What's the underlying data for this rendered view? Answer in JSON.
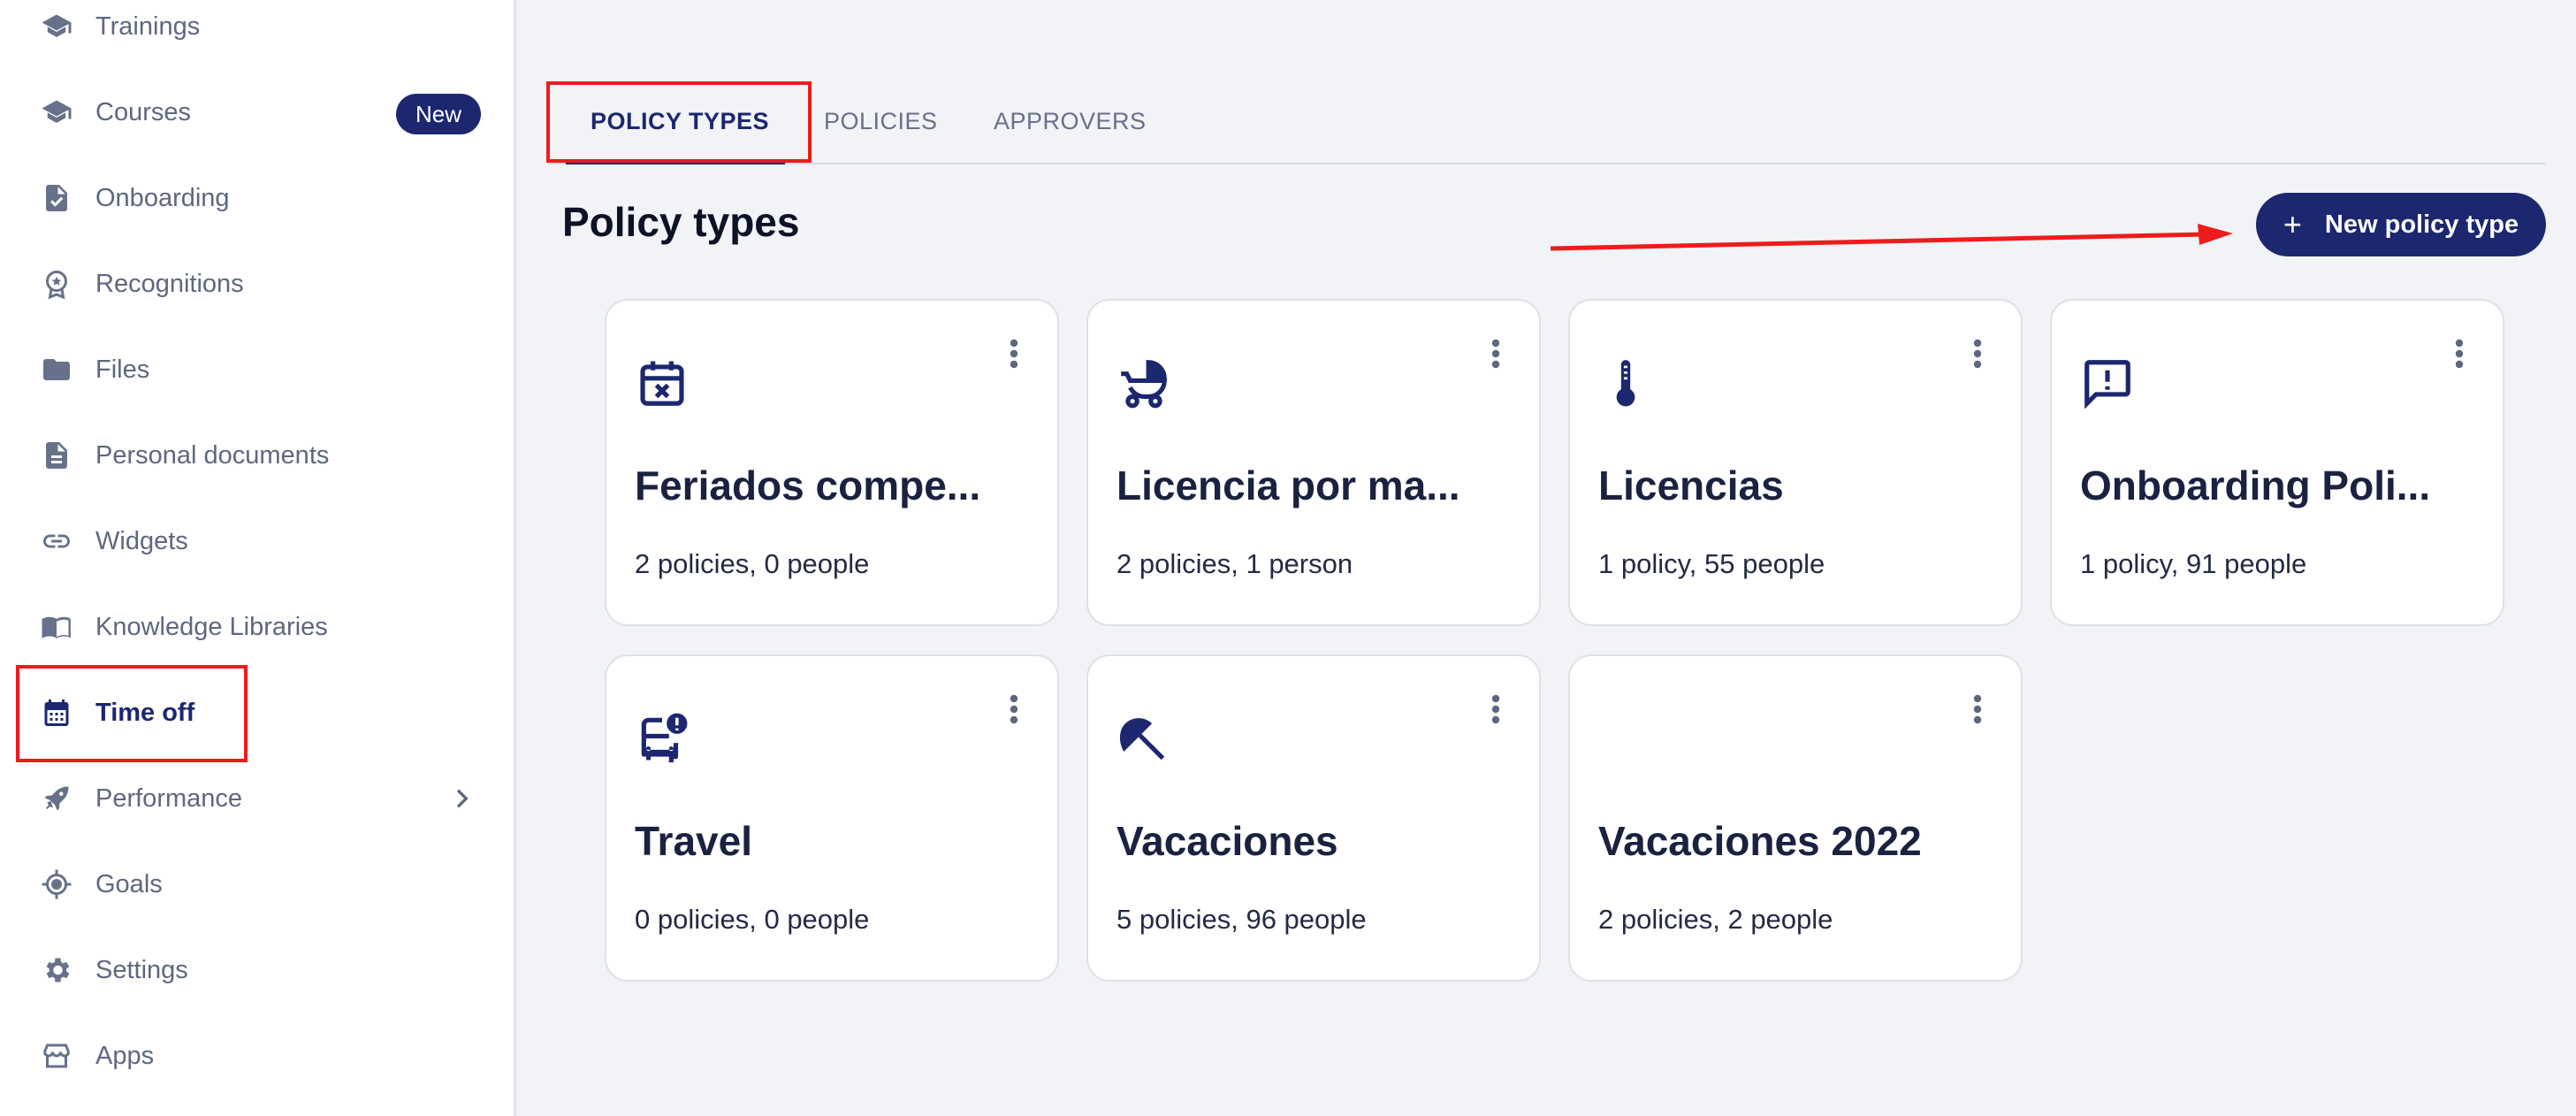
{
  "sidebar": {
    "items": [
      {
        "label": "Trainings",
        "icon": "graduation-cap-icon"
      },
      {
        "label": "Courses",
        "icon": "graduation-cap-icon",
        "badge": "New"
      },
      {
        "label": "Onboarding",
        "icon": "document-check-icon"
      },
      {
        "label": "Recognitions",
        "icon": "award-badge-icon"
      },
      {
        "label": "Files",
        "icon": "folder-icon"
      },
      {
        "label": "Personal documents",
        "icon": "document-icon"
      },
      {
        "label": "Widgets",
        "icon": "link-icon"
      },
      {
        "label": "Knowledge Libraries",
        "icon": "book-icon"
      },
      {
        "label": "Time off",
        "icon": "calendar-icon",
        "active": true
      },
      {
        "label": "Performance",
        "icon": "rocket-icon"
      },
      {
        "label": "Goals",
        "icon": "target-icon"
      },
      {
        "label": "Settings",
        "icon": "gear-icon"
      },
      {
        "label": "Apps",
        "icon": "store-icon"
      }
    ]
  },
  "tabs": [
    {
      "label": "POLICY TYPES",
      "active": true
    },
    {
      "label": "POLICIES"
    },
    {
      "label": "APPROVERS"
    }
  ],
  "page_title": "Policy types",
  "new_button": {
    "plus": "+",
    "label": "New policy type"
  },
  "cards": [
    {
      "title": "Feriados compe...",
      "subtitle": "2 policies, 0 people",
      "icon": "calendar-x-icon"
    },
    {
      "title": "Licencia por ma...",
      "subtitle": "2 policies, 1 person",
      "icon": "stroller-icon"
    },
    {
      "title": "Licencias",
      "subtitle": "1 policy, 55 people",
      "icon": "thermometer-icon"
    },
    {
      "title": "Onboarding Poli...",
      "subtitle": "1 policy, 91 people",
      "icon": "message-alert-icon"
    },
    {
      "title": "Travel",
      "subtitle": "0 policies, 0 people",
      "icon": "bus-alert-icon"
    },
    {
      "title": "Vacaciones",
      "subtitle": "5 policies, 96 people",
      "icon": "beach-umbrella-icon"
    },
    {
      "title": "Vacaciones 2022",
      "subtitle": "2 policies, 2 people",
      "icon": ""
    }
  ],
  "colors": {
    "accent": "#1c2770",
    "highlight": "#ee1c1c",
    "background": "#f2f3f6"
  }
}
